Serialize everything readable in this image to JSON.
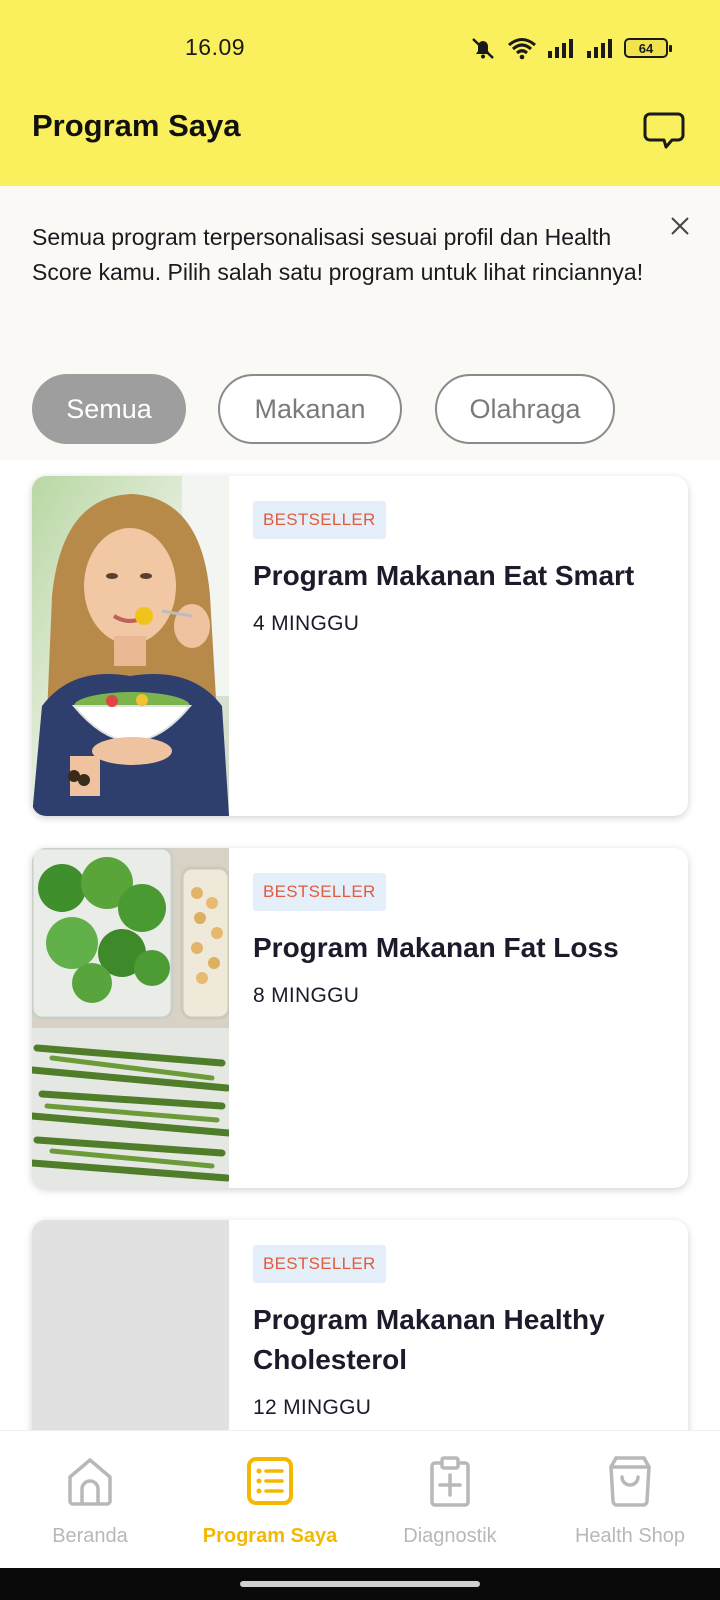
{
  "status_bar": {
    "time": "16.09",
    "battery": "64"
  },
  "header": {
    "title": "Program Saya"
  },
  "info_banner": {
    "text": "Semua program terpersonalisasi sesuai profil dan Health Score kamu. Pilih salah satu program untuk lihat rinciannya!"
  },
  "filters": {
    "chips": [
      {
        "label": "Semua",
        "selected": true
      },
      {
        "label": "Makanan",
        "selected": false
      },
      {
        "label": "Olahraga",
        "selected": false
      }
    ]
  },
  "programs": [
    {
      "badge": "BESTSELLER",
      "title": "Program Makanan Eat Smart",
      "duration": "4 MINGGU",
      "image": "woman-eating-salad"
    },
    {
      "badge": "BESTSELLER",
      "title": "Program Makanan Fat Loss",
      "duration": "8 MINGGU",
      "image": "broccoli-green-beans"
    },
    {
      "badge": "BESTSELLER",
      "title": "Program Makanan Healthy Cholesterol",
      "duration": "12 MINGGU",
      "image": "placeholder"
    }
  ],
  "bottom_nav": {
    "items": [
      {
        "label": "Beranda",
        "icon": "home-icon",
        "active": false
      },
      {
        "label": "Program Saya",
        "icon": "list-icon",
        "active": true
      },
      {
        "label": "Diagnostik",
        "icon": "clipboard-plus-icon",
        "active": false
      },
      {
        "label": "Health Shop",
        "icon": "shopping-bag-icon",
        "active": false
      }
    ]
  },
  "colors": {
    "header_bg": "#faef5c",
    "accent": "#f5b800",
    "badge_text": "#e25b3f",
    "badge_bg": "#e4effa"
  }
}
